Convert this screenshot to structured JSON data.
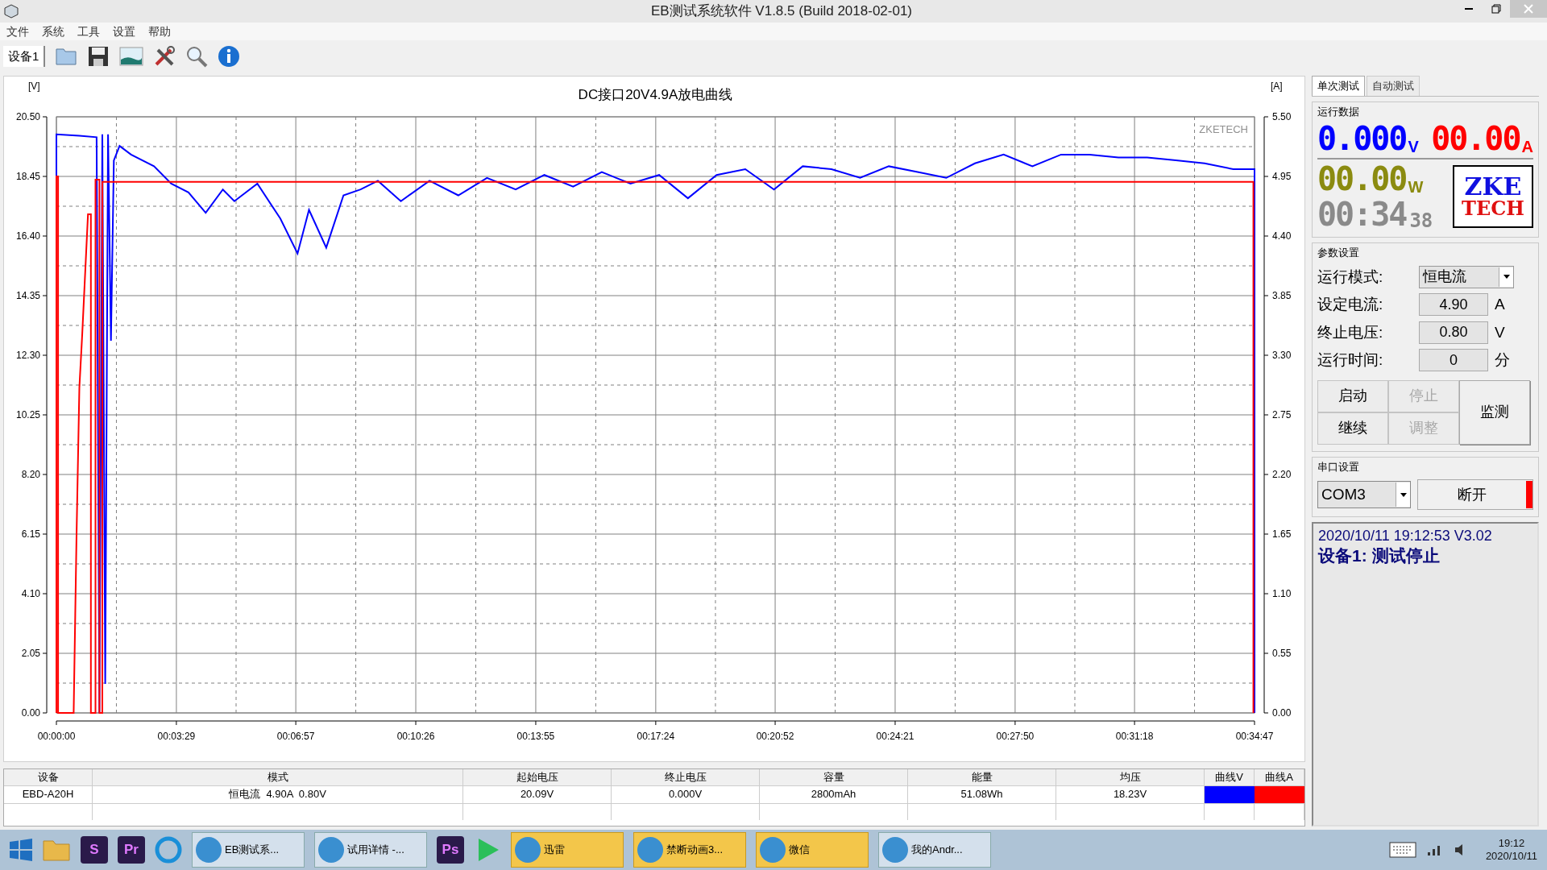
{
  "window": {
    "title": "EB测试系统软件 V1.8.5 (Build 2018-02-01)"
  },
  "menu": [
    "文件",
    "系统",
    "工具",
    "设置",
    "帮助"
  ],
  "toolbar": {
    "device_tab": "设备1"
  },
  "chart": {
    "y_unit": "[V]",
    "y2_unit": "[A]",
    "watermark": "ZKETECH",
    "chart_data": {
      "type": "line",
      "grid": true,
      "title": "DC接口20V4.9A放电曲线",
      "xlim": [
        0,
        2087
      ],
      "xticks": [
        {
          "value": 0,
          "label": "00:00:00"
        },
        {
          "value": 209,
          "label": "00:03:29"
        },
        {
          "value": 417,
          "label": "00:06:57"
        },
        {
          "value": 626,
          "label": "00:10:26"
        },
        {
          "value": 835,
          "label": "00:13:55"
        },
        {
          "value": 1044,
          "label": "00:17:24"
        },
        {
          "value": 1252,
          "label": "00:20:52"
        },
        {
          "value": 1461,
          "label": "00:24:21"
        },
        {
          "value": 1670,
          "label": "00:27:50"
        },
        {
          "value": 1878,
          "label": "00:31:18"
        },
        {
          "value": 2087,
          "label": "00:34:47"
        }
      ],
      "ylim": [
        0,
        20.5
      ],
      "yticks": [
        {
          "value": 0,
          "label": "0.00"
        },
        {
          "value": 2.05,
          "label": "2.05"
        },
        {
          "value": 4.1,
          "label": "4.10"
        },
        {
          "value": 6.15,
          "label": "6.15"
        },
        {
          "value": 8.2,
          "label": "8.20"
        },
        {
          "value": 10.25,
          "label": "10.25"
        },
        {
          "value": 12.3,
          "label": "12.30"
        },
        {
          "value": 14.35,
          "label": "14.35"
        },
        {
          "value": 16.4,
          "label": "16.40"
        },
        {
          "value": 18.45,
          "label": "18.45"
        },
        {
          "value": 20.5,
          "label": "20.50"
        }
      ],
      "y2lim": [
        0,
        5.5
      ],
      "y2ticks": [
        {
          "value": 0,
          "label": "0.00"
        },
        {
          "value": 0.55,
          "label": "0.55"
        },
        {
          "value": 1.1,
          "label": "1.10"
        },
        {
          "value": 1.65,
          "label": "1.65"
        },
        {
          "value": 2.2,
          "label": "2.20"
        },
        {
          "value": 2.75,
          "label": "2.75"
        },
        {
          "value": 3.3,
          "label": "3.30"
        },
        {
          "value": 3.85,
          "label": "3.85"
        },
        {
          "value": 4.4,
          "label": "4.40"
        },
        {
          "value": 4.95,
          "label": "4.95"
        },
        {
          "value": 5.5,
          "label": "5.50"
        }
      ],
      "series": [
        {
          "color": "#0000ff",
          "x": [
            0,
            0,
            40,
            70,
            75,
            80,
            85,
            90,
            95,
            100,
            110,
            130,
            170,
            200,
            230,
            260,
            290,
            310,
            350,
            390,
            420,
            440,
            470,
            500,
            530,
            560,
            600,
            650,
            700,
            750,
            800,
            850,
            900,
            950,
            1000,
            1050,
            1100,
            1150,
            1200,
            1250,
            1300,
            1350,
            1400,
            1450,
            1500,
            1550,
            1600,
            1650,
            1700,
            1750,
            1800,
            1850,
            1900,
            1950,
            2000,
            2050,
            2087,
            2087
          ],
          "values": [
            0,
            19.9,
            19.85,
            19.8,
            0,
            19.9,
            1.0,
            19.9,
            12.8,
            19.0,
            19.5,
            19.2,
            18.8,
            18.2,
            17.9,
            17.2,
            18.0,
            17.6,
            18.2,
            17.0,
            15.8,
            17.3,
            16.0,
            17.8,
            18.0,
            18.3,
            17.6,
            18.3,
            17.8,
            18.4,
            18.0,
            18.5,
            18.1,
            18.6,
            18.2,
            18.5,
            17.7,
            18.5,
            18.7,
            18.0,
            18.8,
            18.7,
            18.4,
            18.8,
            18.6,
            18.4,
            18.9,
            19.2,
            18.8,
            19.2,
            19.2,
            19.1,
            19.1,
            19.0,
            18.9,
            18.7,
            18.7,
            0
          ]
        },
        {
          "color": "#ff0000",
          "axis": "y2",
          "x": [
            0,
            0,
            3,
            3,
            30,
            35,
            40,
            45,
            55,
            60,
            60,
            68,
            68,
            75,
            75,
            80,
            80,
            2085,
            2085
          ],
          "values": [
            0,
            4.95,
            4.95,
            0,
            0,
            1.6,
            3.0,
            3.5,
            4.6,
            4.6,
            0,
            0,
            4.92,
            4.92,
            0,
            0,
            4.9,
            4.9,
            0
          ]
        }
      ]
    }
  },
  "side": {
    "tabs": [
      {
        "label": "单次测试",
        "selected": true
      },
      {
        "label": "自动测试",
        "selected": false
      }
    ],
    "run_data": {
      "title": "运行数据",
      "voltage": "0.000",
      "voltage_unit": "V",
      "current": "00.00",
      "current_unit": "A",
      "power": "00.00",
      "power_unit": "W",
      "time": "00:34",
      "time_seconds": "38",
      "logo_top": "ZKE",
      "logo_bottom": "TECH"
    },
    "params": {
      "title": "参数设置",
      "fields": [
        {
          "kind": "select",
          "label": "运行模式:",
          "value": "恒电流"
        },
        {
          "kind": "input",
          "label": "设定电流:",
          "value": "4.90",
          "unit": "A"
        },
        {
          "kind": "input",
          "label": "终止电压:",
          "value": "0.80",
          "unit": "V"
        },
        {
          "kind": "input",
          "label": "运行时间:",
          "value": "0",
          "unit": "分"
        }
      ],
      "buttons": [
        {
          "label": "启动",
          "disabled": false
        },
        {
          "label": "停止",
          "disabled": true
        },
        {
          "label": "继续",
          "disabled": false
        },
        {
          "label": "调整",
          "disabled": true
        }
      ],
      "monitor_button": "监测"
    },
    "serial": {
      "title": "串口设置",
      "port": "COM3",
      "button": "断开",
      "connected": true
    },
    "log": [
      "2020/10/11 19:12:53  V3.02",
      "设备1: 测试停止"
    ]
  },
  "table": {
    "columns": [
      "设备",
      "模式",
      "起始电压",
      "终止电压",
      "容量",
      "能量",
      "均压",
      "曲线V",
      "曲线A"
    ],
    "rows": [
      {
        "cells": [
          "EBD-A20H",
          "恒电流  4.90A  0.80V",
          "20.09V",
          "0.000V",
          "2800mAh",
          "51.08Wh",
          "18.23V"
        ],
        "curves": [
          {
            "color": "#0000ff"
          },
          {
            "color": "#ff0000"
          }
        ]
      }
    ]
  },
  "taskbar": {
    "items": [
      {
        "kind": "start"
      },
      {
        "kind": "folder"
      },
      {
        "kind": "app",
        "badge": "S"
      },
      {
        "kind": "app",
        "badge": "Pr"
      },
      {
        "kind": "circle"
      },
      {
        "kind": "window",
        "label": "EB测试系...",
        "highlighted": false
      },
      {
        "kind": "window",
        "label": "试用详情 -...",
        "highlighted": false
      },
      {
        "kind": "app",
        "badge": "Ps"
      },
      {
        "kind": "play"
      },
      {
        "kind": "window",
        "label": "迅雷",
        "highlighted": true
      },
      {
        "kind": "window",
        "label": "禁断动画3...",
        "highlighted": true
      },
      {
        "kind": "window",
        "label": "微信",
        "highlighted": true
      },
      {
        "kind": "window",
        "label": "我的Andr...",
        "highlighted": false
      }
    ],
    "time": "19:12",
    "date": "2020/10/11"
  }
}
